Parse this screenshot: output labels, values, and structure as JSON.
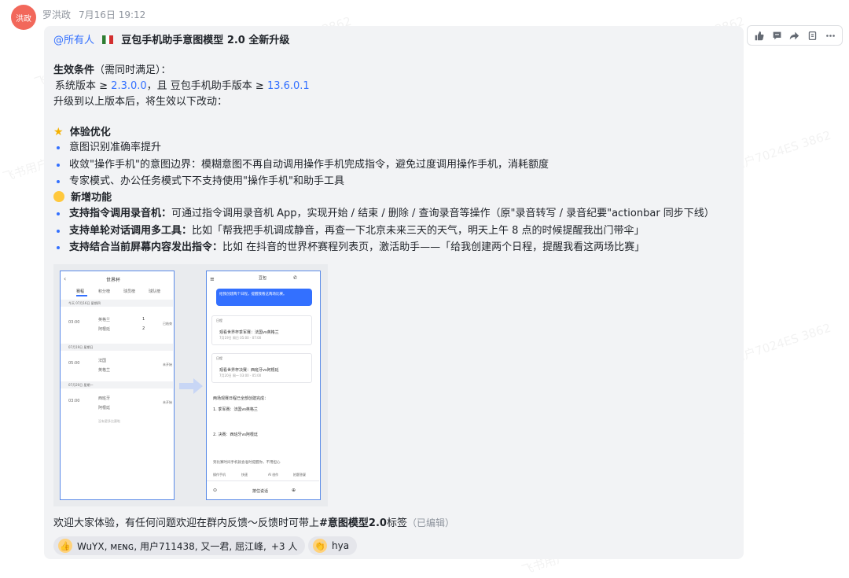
{
  "sender": {
    "avatar_text": "洪政",
    "name": "罗洪政",
    "time": "7月16日 19:12"
  },
  "toolbar": {
    "icons": [
      "thumbs-up-icon",
      "comment-icon",
      "forward-icon",
      "add-reaction-icon",
      "more-icon"
    ]
  },
  "message": {
    "mention": "@所有人",
    "title": "豆包手机助手意图模型 2.0 全新升级",
    "cond_title": "生效条件",
    "cond_note": "（需同时满足）：",
    "version_prefix": "系统版本 ≥ ",
    "system_version": "2.3.0.0",
    "version_mid": "，且 豆包手机助手版本 ≥ ",
    "app_version": "13.6.0.1",
    "upgrade_note": "升级到以上版本后，将生效以下改动：",
    "section1_title": "体验优化",
    "section1_items": [
      "意图识别准确率提升",
      "收敛\"操作手机\"的意图边界：模糊意图不再自动调用操作手机完成指令，避免过度调用操作手机，消耗额度",
      "专家模式、办公任务模式下不支持使用\"操作手机\"和助手工具"
    ],
    "section2_title": "新增功能",
    "section2_items": [
      {
        "bold": "支持指令调用录音机：",
        "text": "可通过指令调用录音机 App，实现开始 / 结束 / 删除 / 查询录音等操作（原\"录音转写 / 录音纪要\"actionbar 同步下线）"
      },
      {
        "bold": "支持单轮对话调用多工具：",
        "text": "比如「帮我把手机调成静音，再查一下北京未来三天的天气，明天上午 8 点的时候提醒我出门带伞」"
      },
      {
        "bold": "支持结合当前屏幕内容发出指令：",
        "text": "比如 在抖音的世界杯赛程列表页，激活助手——「给我创建两个日程，提醒我看这两场比赛」"
      }
    ],
    "footer_text": "欢迎大家体验，有任何问题欢迎在群内反馈～反馈时可带上",
    "footer_tag": "#意图模型2.0",
    "footer_tail": "标签",
    "edited": "（已编辑）"
  },
  "screenshot": {
    "left_title": "世界杯",
    "left_tabs": [
      "赛程",
      "积分榜",
      "球员榜",
      "球队榜"
    ],
    "left_date1": "今天 07月16日 星期四",
    "match1": {
      "time": "03:00",
      "team1": "英格兰",
      "team2": "阿根廷",
      "score1": "1",
      "score2": "2",
      "status": "已结束"
    },
    "left_date2": "07月19日 星期日",
    "match2": {
      "time": "05:00",
      "team1": "法国",
      "team2": "英格兰",
      "status": "未开始"
    },
    "left_date3": "07月20日 星期一",
    "match3": {
      "time": "03:00",
      "team1": "西班牙",
      "team2": "阿根廷",
      "status": "未开始"
    },
    "left_footer": "没有更多比赛啦",
    "right_title": "豆包",
    "right_user_msg": "给我创建两个日程，提醒我看这两场比赛。",
    "cal_label": "日程",
    "event1": "观看世界杯季军赛：法国vs英格兰",
    "event1_time": "7月19日 周日 05:00 - 07:00",
    "event2": "观看世界杯决赛：西班牙vs阿根廷",
    "event2_time": "7月20日 周一 03:00 - 05:00",
    "summary_title": "两场观赛日程已全部创建完成：",
    "summary_items": [
      "1. 季军赛：法国vs英格兰",
      "2. 决赛：西班牙vs阿根廷"
    ],
    "summary_note": "到比赛时间手机就会准时提醒你，不用担心",
    "actions": [
      "操作手机",
      "快速",
      "AI 创作",
      "拍题答疑"
    ],
    "input_placeholder": "按住说话"
  },
  "reactions": [
    {
      "emoji": "thumbs-up-icon",
      "users": "WuYX, ᴍᴇɴɢ, 用户711438, 又一君, 屈江峰,",
      "more": "+3 人"
    },
    {
      "emoji": "clap-icon",
      "users": "hya"
    }
  ],
  "watermark": "飞书用户7024ES 3862",
  "colors": {
    "accent": "#3370ff",
    "avatar": "#f2685b",
    "bubble": "#f2f3f5"
  }
}
